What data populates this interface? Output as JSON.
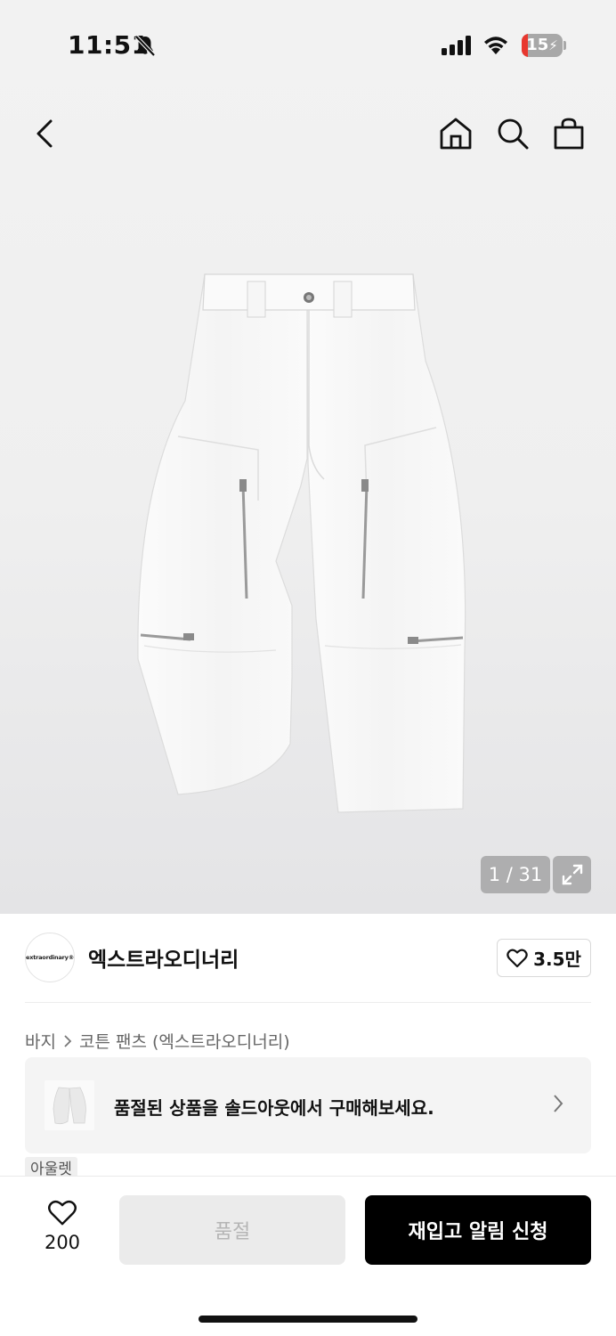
{
  "status_bar": {
    "time": "11:51",
    "battery_level": "15",
    "battery_fraction": 0.15,
    "icons": [
      "bell-off-icon",
      "signal-icon",
      "wifi-icon",
      "battery-icon"
    ]
  },
  "nav": {
    "icons": [
      "back-icon",
      "home-icon",
      "search-icon",
      "shopping-bag-icon"
    ]
  },
  "gallery": {
    "counter": "1 / 31",
    "expand_icon": "expand-icon"
  },
  "brand": {
    "logo_text": "extraordinary®",
    "name": "엑스트라오디너리",
    "likes": "3.5만"
  },
  "breadcrumb": {
    "category": "바지",
    "product": "코튼 팬츠 (엑스트라오디너리)"
  },
  "soldout_banner": {
    "text": "품절된 상품을 솔드아웃에서 구매해보세요."
  },
  "tag": "아울렛",
  "bottom_bar": {
    "like_count": "200",
    "soldout_label": "품절",
    "restock_label": "재입고 알림 신청"
  },
  "colors": {
    "primary_button": "#000000",
    "disabled_button": "#ebebeb",
    "battery_low": "#e8382f"
  }
}
